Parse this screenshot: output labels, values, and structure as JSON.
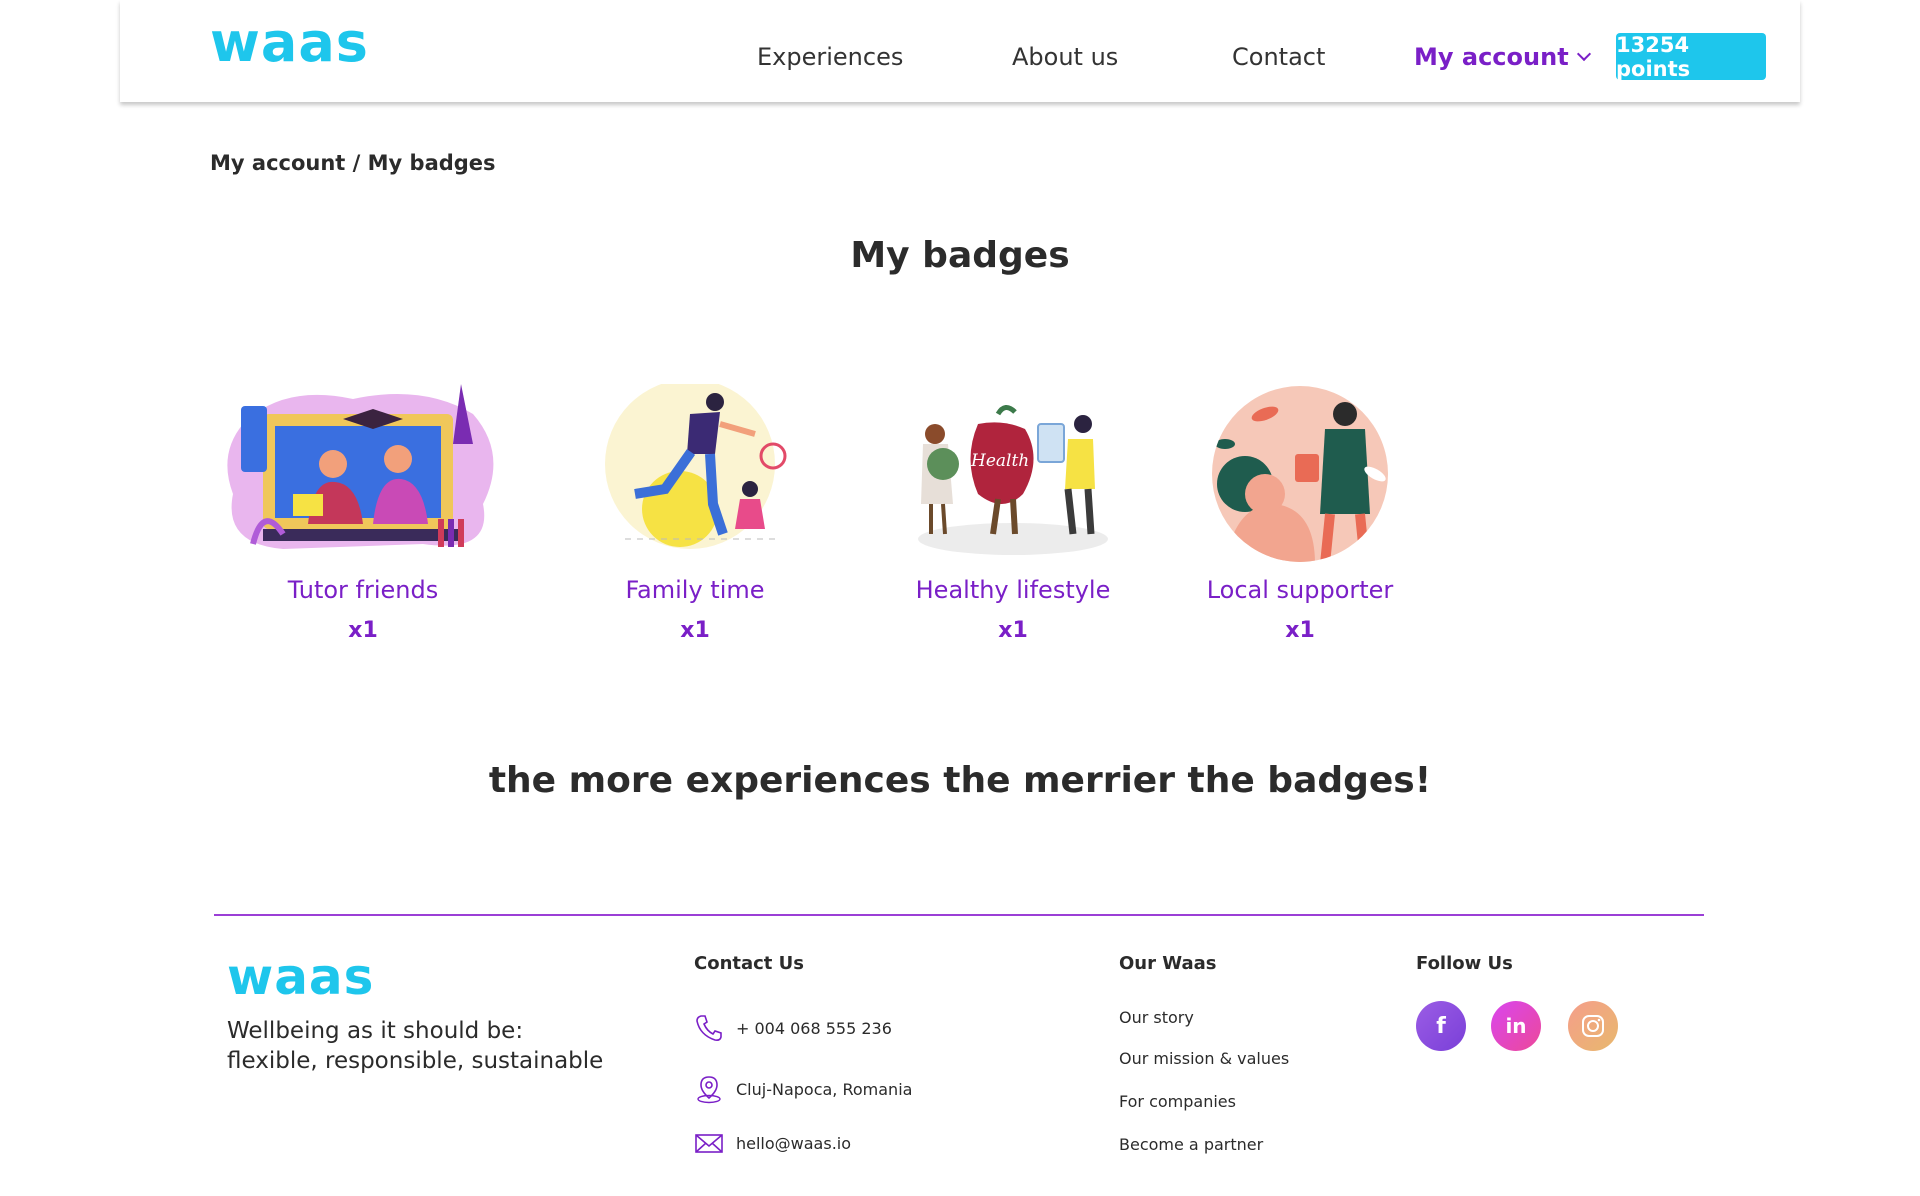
{
  "header": {
    "logo": "waas",
    "nav": {
      "experiences": "Experiences",
      "about": "About us",
      "contact": "Contact",
      "account": "My account"
    },
    "points": "13254 points"
  },
  "breadcrumb": {
    "root": "My account",
    "separator": " / ",
    "current": "My badges"
  },
  "page_title": "My badges",
  "badges": [
    {
      "name": "Tutor friends",
      "count": "x1"
    },
    {
      "name": "Family time",
      "count": "x1"
    },
    {
      "name": "Healthy lifestyle",
      "count": "x1",
      "illustration_text": "Health"
    },
    {
      "name": "Local supporter",
      "count": "x1"
    }
  ],
  "tagline": "the more experiences the merrier the badges!",
  "footer": {
    "logo": "waas",
    "tagline_line1": "Wellbeing as it should be:",
    "tagline_line2": "flexible, responsible, sustainable",
    "contact_heading": "Contact Us",
    "phone": "+ 004 068 555 236",
    "location": "Cluj-Napoca, Romania",
    "email": "hello@waas.io",
    "our_heading": "Our Waas",
    "links": [
      "Our story",
      "Our mission & values",
      "For companies",
      "Become a partner"
    ],
    "follow_heading": "Follow Us",
    "social": {
      "facebook": "f",
      "linkedin": "in"
    }
  },
  "colors": {
    "brand": "#1ec6ec",
    "accent": "#7a1fc7",
    "divider": "#9b3fd6"
  }
}
